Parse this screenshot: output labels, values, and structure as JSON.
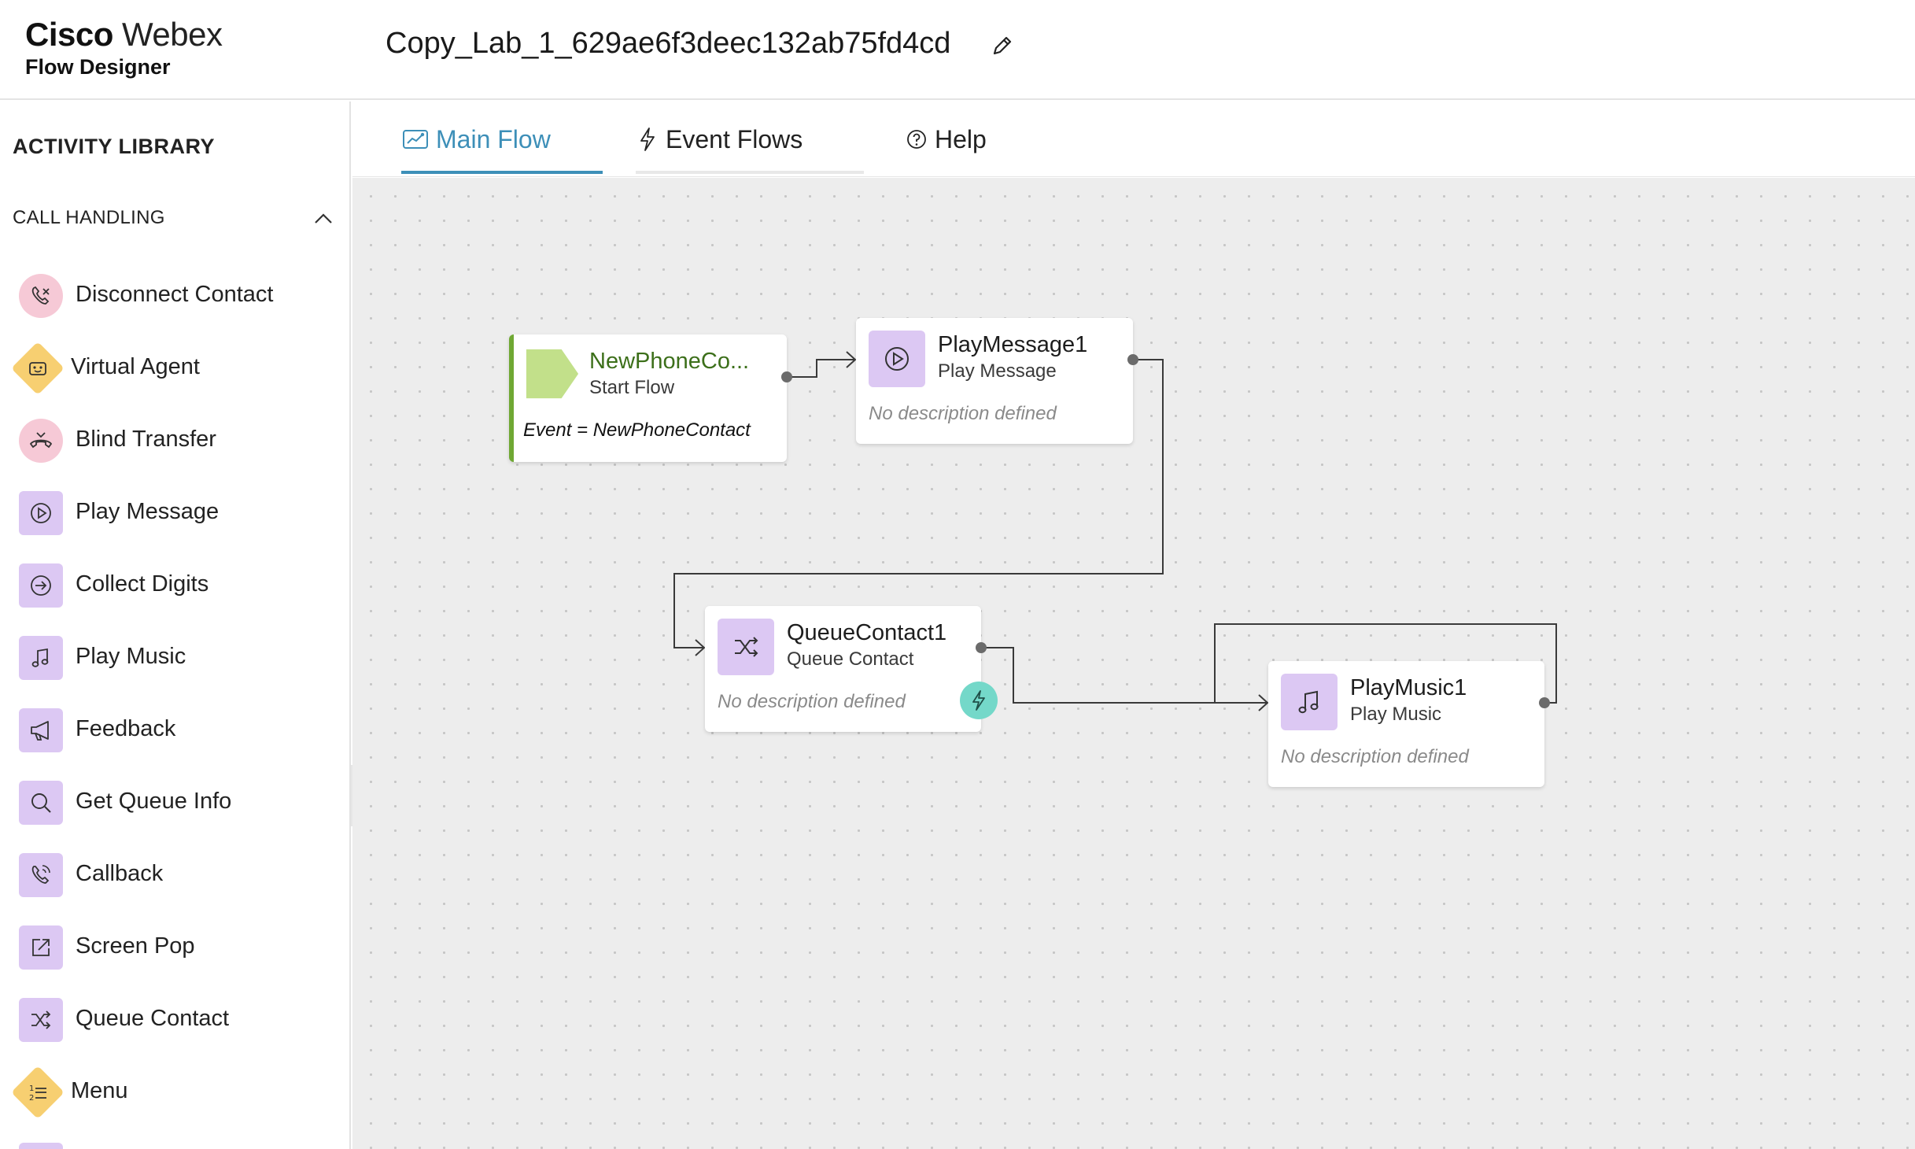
{
  "header": {
    "brand_bold": "Cisco",
    "brand_light": "Webex",
    "product": "Flow Designer",
    "flow_name": "Copy_Lab_1_629ae6f3deec132ab75fd4cd",
    "edit_icon": "pencil-icon"
  },
  "sidebar": {
    "title": "ACTIVITY LIBRARY",
    "section": "CALL HANDLING",
    "section_state": "expanded",
    "items": [
      {
        "label": "Disconnect Contact",
        "icon": "phone-disconnect-icon",
        "shape": "circle"
      },
      {
        "label": "Virtual Agent",
        "icon": "bot-icon",
        "shape": "diamond"
      },
      {
        "label": "Blind Transfer",
        "icon": "phone-transfer-icon",
        "shape": "circle"
      },
      {
        "label": "Play Message",
        "icon": "play-circle-icon",
        "shape": "square"
      },
      {
        "label": "Collect Digits",
        "icon": "arrow-circle-icon",
        "shape": "square"
      },
      {
        "label": "Play Music",
        "icon": "music-note-icon",
        "shape": "square"
      },
      {
        "label": "Feedback",
        "icon": "megaphone-icon",
        "shape": "square"
      },
      {
        "label": "Get Queue Info",
        "icon": "search-icon",
        "shape": "square"
      },
      {
        "label": "Callback",
        "icon": "phone-callback-icon",
        "shape": "square"
      },
      {
        "label": "Screen Pop",
        "icon": "external-link-icon",
        "shape": "square"
      },
      {
        "label": "Queue Contact",
        "icon": "shuffle-icon",
        "shape": "square"
      },
      {
        "label": "Menu",
        "icon": "numbered-list-icon",
        "shape": "diamond"
      }
    ]
  },
  "tabs": [
    {
      "label": "Main Flow",
      "icon": "flow-icon",
      "active": true
    },
    {
      "label": "Event Flows",
      "icon": "lightning-icon",
      "active": false
    },
    {
      "label": "Help",
      "icon": "help-circle-icon",
      "active": false
    }
  ],
  "canvas": {
    "nodes": {
      "start": {
        "title": "NewPhoneCo...",
        "type": "Start Flow",
        "event": "Event = NewPhoneContact"
      },
      "play_message": {
        "title": "PlayMessage1",
        "type": "Play Message",
        "description": "No description defined"
      },
      "queue_contact": {
        "title": "QueueContact1",
        "type": "Queue Contact",
        "description": "No description defined"
      },
      "play_music": {
        "title": "PlayMusic1",
        "type": "Play Music",
        "description": "No description defined"
      }
    },
    "edges": [
      {
        "from": "NewPhoneCo...",
        "to": "PlayMessage1"
      },
      {
        "from": "PlayMessage1",
        "to": "QueueContact1"
      },
      {
        "from": "QueueContact1",
        "to": "PlayMusic1"
      },
      {
        "from": "PlayMusic1",
        "to": "PlayMusic1"
      }
    ]
  },
  "colors": {
    "accent": "#3d8fb8",
    "activity_purple": "#dcc8f3",
    "activity_pink": "#f6c9d6",
    "activity_yellow": "#f7cf71",
    "start_green": "#c2e08a",
    "event_teal": "#74d8c9"
  }
}
